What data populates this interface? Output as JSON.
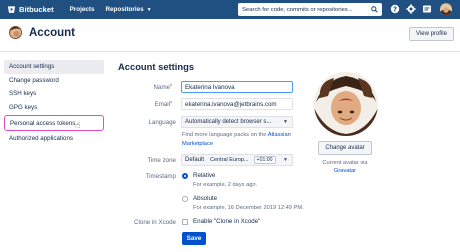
{
  "topbar": {
    "brand": "Bitbucket",
    "nav": [
      {
        "label": "Projects"
      },
      {
        "label": "Repositories"
      }
    ],
    "search_placeholder": "Search for code, commits or repositories...",
    "icons": [
      "help-icon",
      "settings-icon",
      "notifications-icon",
      "user-avatar"
    ]
  },
  "header": {
    "title": "Account",
    "view_profile": "View profile"
  },
  "sidebar": {
    "items": [
      {
        "label": "Account settings"
      },
      {
        "label": "Change password"
      },
      {
        "label": "SSH keys"
      },
      {
        "label": "GPG keys"
      },
      {
        "label": "Personal access tokens"
      },
      {
        "label": "Authorized applications"
      }
    ],
    "active_index": 0,
    "highlighted_index": 4
  },
  "form": {
    "title": "Account settings",
    "name_label": "Name",
    "name_value": "Ekaterina Ivanova",
    "email_label": "Email",
    "email_value": "ekaterina.ivanova@jetbrains.com",
    "language_label": "Language",
    "language_value": "Automatically detect browser s...",
    "language_help_prefix": "Find more language packs on the ",
    "language_help_link1": "Atlassian",
    "language_help_link2": "Marketplace",
    "timezone_label": "Time zone",
    "timezone_default": "Default",
    "timezone_value": "Central Europ...",
    "timezone_offset": "+01:00",
    "timestamp_label": "Timestamp",
    "relative_label": "Relative",
    "relative_example": "For example, 2 days ago.",
    "absolute_label": "Absolute",
    "absolute_example": "For example, 16 December 2019 12:49 PM.",
    "clone_label": "Clone in Xcode",
    "clone_option": "Enable \"Clone in Xcode\"",
    "save": "Save"
  },
  "avatar": {
    "change_button": "Change avatar",
    "note_line1": "Current avatar via",
    "note_link": "Gravatar"
  },
  "colors": {
    "topbar": "#205081",
    "accent": "#0052cc",
    "highlight": "#e24cc9"
  }
}
